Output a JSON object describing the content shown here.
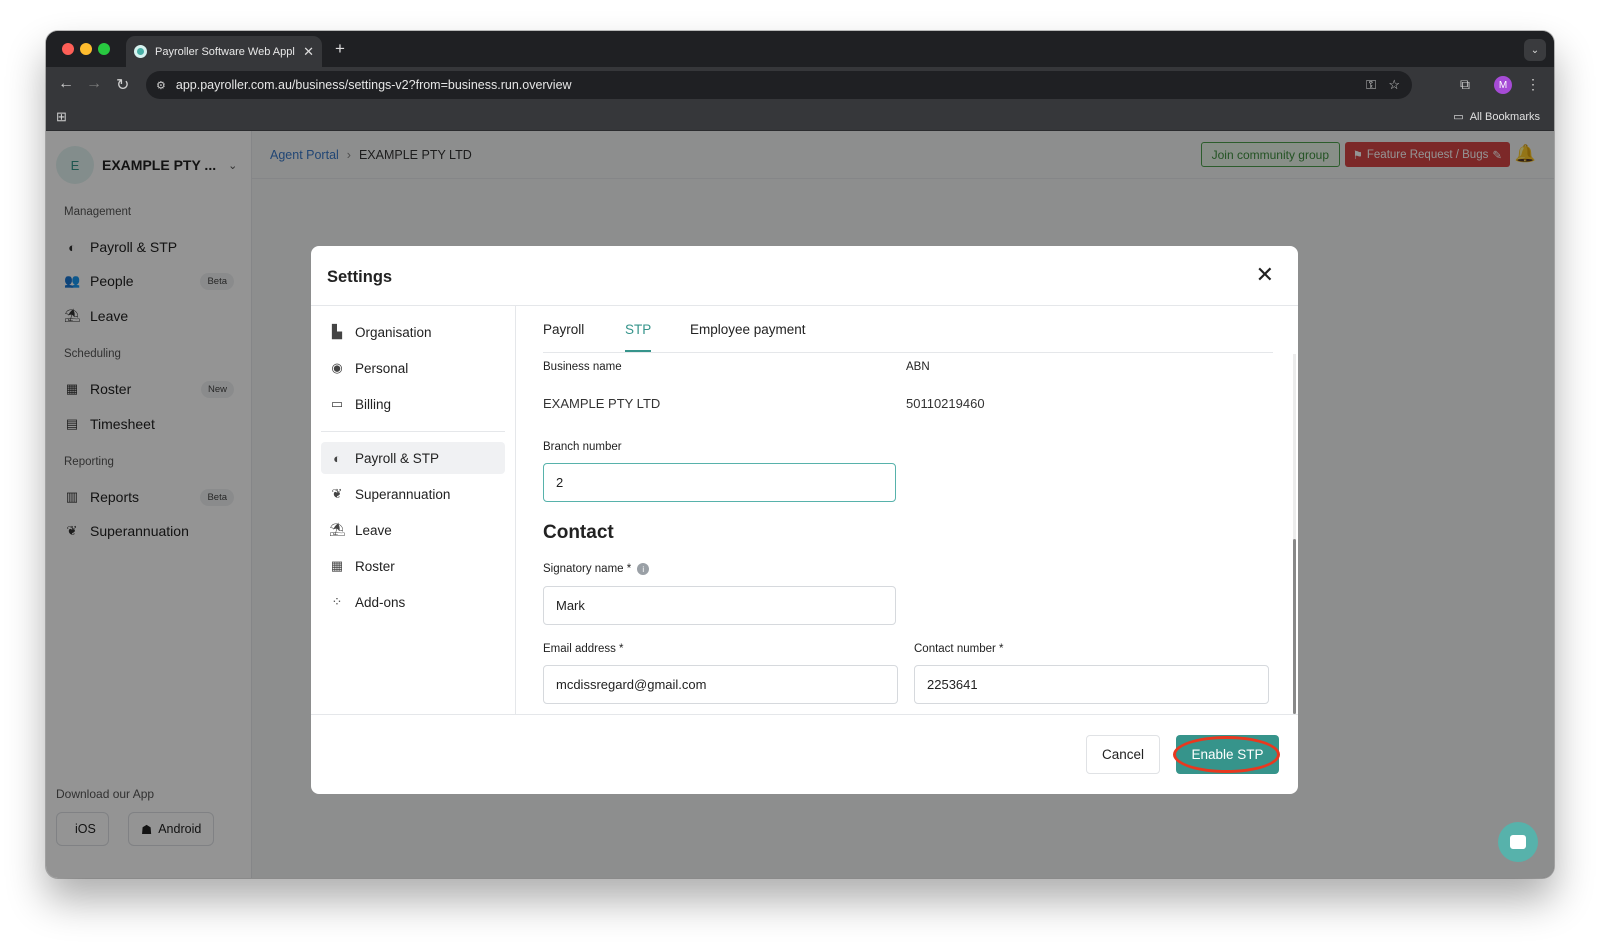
{
  "browser": {
    "tab_title": "Payroller Software Web Appli",
    "url": "app.payroller.com.au/business/settings-v2?from=business.run.overview",
    "bookmarks_label": "All Bookmarks",
    "profile_initial": "M"
  },
  "sidebar": {
    "org_initial": "E",
    "org_name": "EXAMPLE PTY ...",
    "sections": {
      "management": "Management",
      "scheduling": "Scheduling",
      "reporting": "Reporting"
    },
    "items": [
      {
        "label": "Payroll & STP",
        "icon": "payroll-icon"
      },
      {
        "label": "People",
        "icon": "people-icon",
        "badge": "Beta"
      },
      {
        "label": "Leave",
        "icon": "leave-icon"
      },
      {
        "label": "Roster",
        "icon": "roster-icon",
        "badge": "New"
      },
      {
        "label": "Timesheet",
        "icon": "timesheet-icon"
      },
      {
        "label": "Reports",
        "icon": "reports-icon",
        "badge": "Beta"
      },
      {
        "label": "Superannuation",
        "icon": "piggybank-icon"
      }
    ],
    "download_label": "Download our App",
    "ios_label": "iOS",
    "android_label": "Android"
  },
  "topbar": {
    "breadcrumb_root": "Agent Portal",
    "breadcrumb_current": "EXAMPLE PTY LTD",
    "join_label": "Join community group",
    "feature_label": "Feature Request / Bugs"
  },
  "modal": {
    "title": "Settings",
    "nav": [
      {
        "label": "Organisation",
        "icon": "building-icon"
      },
      {
        "label": "Personal",
        "icon": "user-icon"
      },
      {
        "label": "Billing",
        "icon": "card-icon"
      },
      {
        "label": "Payroll & STP",
        "icon": "payroll-icon"
      },
      {
        "label": "Superannuation",
        "icon": "piggybank-icon"
      },
      {
        "label": "Leave",
        "icon": "leave-icon"
      },
      {
        "label": "Roster",
        "icon": "roster-icon"
      },
      {
        "label": "Add-ons",
        "icon": "grid-icon"
      }
    ],
    "active_nav": "Payroll & STP",
    "tabs": [
      "Payroll",
      "STP",
      "Employee payment"
    ],
    "active_tab": "STP",
    "business_name_label": "Business name",
    "business_name": "EXAMPLE PTY LTD",
    "abn_label": "ABN",
    "abn": "50110219460",
    "branch_label": "Branch number",
    "branch_value": "2",
    "contact_heading": "Contact",
    "signatory_label": "Signatory name *",
    "signatory_value": "Mark",
    "email_label": "Email address *",
    "email_value": "mcdissregard@gmail.com",
    "phone_label": "Contact number *",
    "phone_value": "2253641",
    "cancel_label": "Cancel",
    "enable_label": "Enable STP"
  },
  "colors": {
    "accent": "#36948b",
    "danger": "#d64545",
    "annotation": "#e8381f"
  }
}
